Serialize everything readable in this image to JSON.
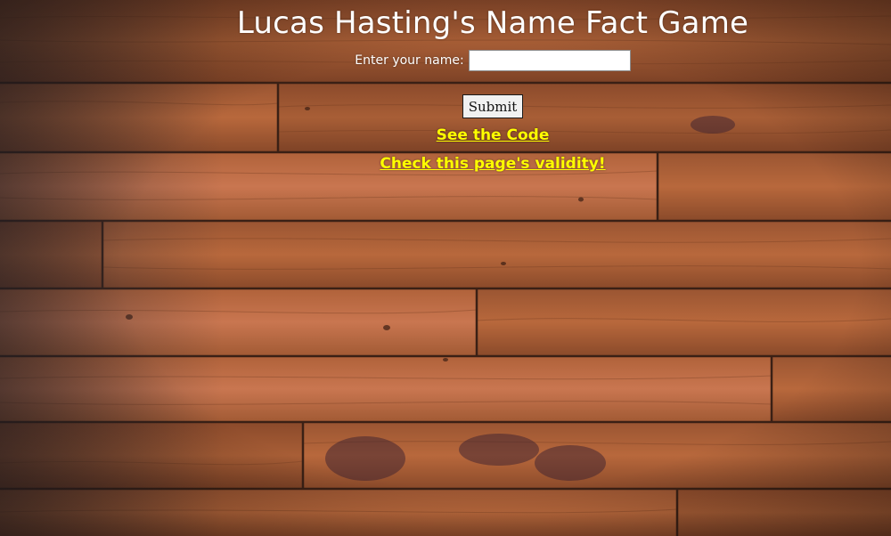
{
  "page": {
    "title": "Lucas Hasting's Name Fact Game"
  },
  "form": {
    "name_label": "Enter your name:",
    "name_value": "",
    "name_placeholder": "",
    "submit_label": "Submit"
  },
  "links": {
    "see_code": "See the Code",
    "check_validity": "Check this page's validity!"
  },
  "colors": {
    "title_text": "#ffffff",
    "link_text": "#ffff00",
    "background": "#7a4426"
  },
  "background": {
    "description_icon": "wood-plank-texture"
  }
}
